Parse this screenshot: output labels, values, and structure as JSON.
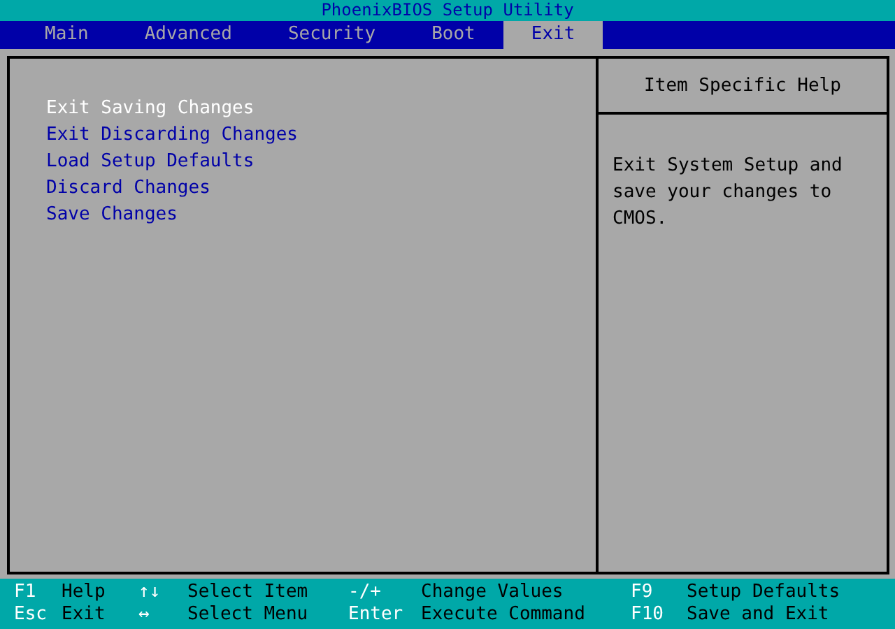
{
  "window": {
    "title": "PhoenixBIOS Setup Utility"
  },
  "tabs": [
    {
      "label": "Main",
      "selected": false
    },
    {
      "label": "Advanced",
      "selected": false
    },
    {
      "label": "Security",
      "selected": false
    },
    {
      "label": "Boot",
      "selected": false
    },
    {
      "label": "Exit",
      "selected": true
    }
  ],
  "menu_items": [
    {
      "label": "Exit Saving Changes",
      "selected": true
    },
    {
      "label": "Exit Discarding Changes",
      "selected": false
    },
    {
      "label": "Load Setup Defaults",
      "selected": false
    },
    {
      "label": "Discard Changes",
      "selected": false
    },
    {
      "label": "Save Changes",
      "selected": false
    }
  ],
  "help_panel": {
    "title": "Item Specific Help",
    "text": "Exit System Setup and save your changes to CMOS."
  },
  "key_legend": [
    [
      {
        "key": "F1",
        "action": "Help"
      },
      {
        "key": "↑↓",
        "action": "Select Item"
      },
      {
        "key": "-/+",
        "action": "Change Values"
      },
      {
        "key": "F9",
        "action": "Setup Defaults"
      }
    ],
    [
      {
        "key": "Esc",
        "action": "Exit"
      },
      {
        "key": "↔",
        "action": "Select Menu"
      },
      {
        "key": "Enter",
        "action": "Execute Command"
      },
      {
        "key": "F10",
        "action": "Save and Exit"
      }
    ]
  ]
}
